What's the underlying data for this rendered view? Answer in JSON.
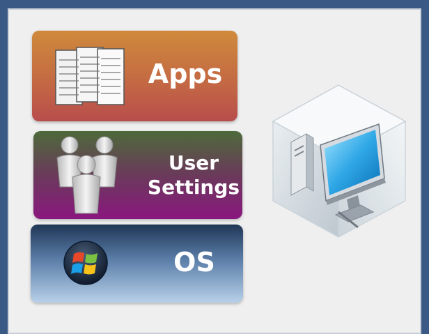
{
  "layers": {
    "apps": {
      "label": "Apps",
      "icon": "documents-icon"
    },
    "user_settings": {
      "label_line1": "User",
      "label_line2": "Settings",
      "icon": "users-icon"
    },
    "os": {
      "label": "OS",
      "icon": "windows-logo-icon"
    }
  },
  "virtual_machine": {
    "icon": "virtual-machine-cube-icon"
  },
  "colors": {
    "frame": "#3a5a85",
    "panel": "#efefef",
    "apps_top": "#cf8a3c",
    "apps_bottom": "#b84d4c",
    "user_top": "#4d6a3a",
    "user_bottom": "#8a177f",
    "os_top": "#203656",
    "os_bottom": "#b8d0e9"
  }
}
